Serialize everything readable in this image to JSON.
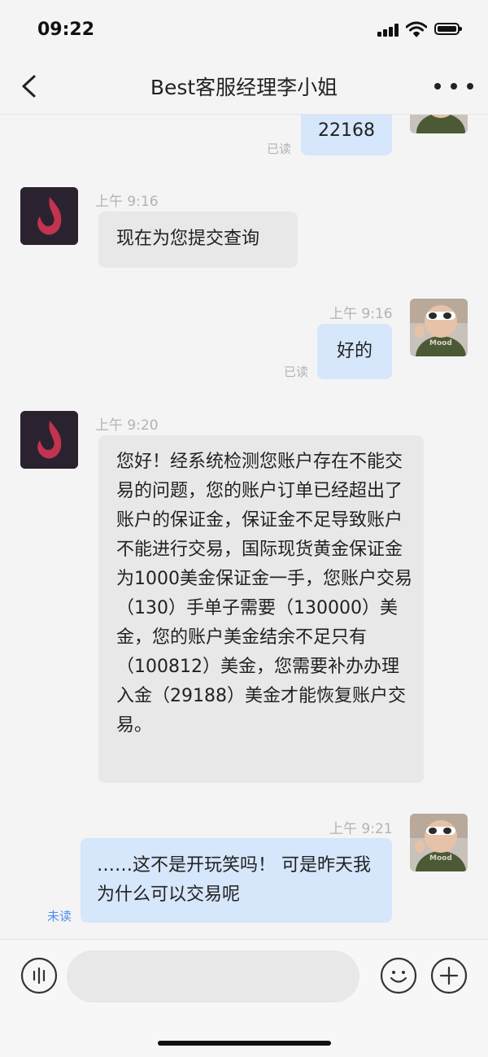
{
  "status_bar": {
    "time": "09:22"
  },
  "header": {
    "title": "Best客服经理李小姐"
  },
  "messages": [
    {
      "side": "out",
      "text": "22168",
      "status": "已读"
    },
    {
      "side": "in",
      "time": "上午 9:16",
      "text": "现在为您提交查询"
    },
    {
      "side": "out",
      "time": "上午 9:16",
      "text": "好的",
      "status": "已读"
    },
    {
      "side": "in",
      "time": "上午 9:20",
      "text": "您好！经系统检测您账户存在不能交易的问题，您的账户订单已经超出了账户的保证金，保证金不足导致账户不能进行交易，国际现货黄金保证金为1000美金保证金一手，您账户交易（130）手单子需要（130000）美金，您的账户美金结余不足只有（100812）美金，您需要补办办理入金（29188）美金才能恢复账户交易。"
    },
    {
      "side": "out",
      "time": "上午 9:21",
      "text": "……这不是开玩笑吗！ 可是昨天我为什么可以交易呢",
      "status": "未读"
    }
  ],
  "colors": {
    "incoming_bubble": "#e8e8e8",
    "outgoing_bubble": "#d6e6fb",
    "unread": "#4e8df0",
    "agent_logo": "#c2334f"
  },
  "icons": [
    "back-arrow-icon",
    "more-icon",
    "voice-icon",
    "emoji-icon",
    "plus-icon",
    "signal-icon",
    "wifi-icon",
    "battery-icon"
  ]
}
